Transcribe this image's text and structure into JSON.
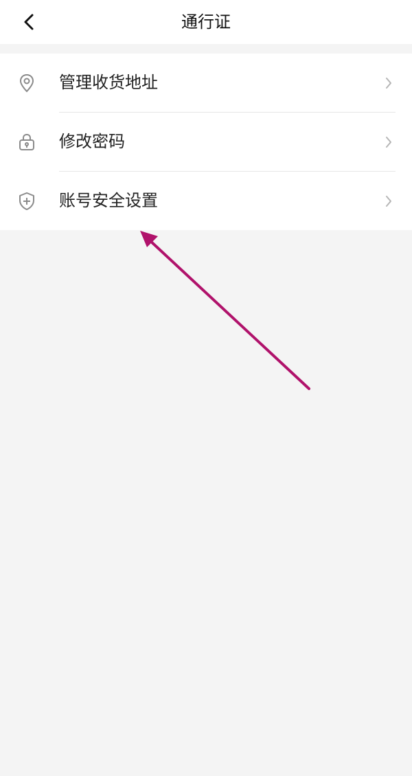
{
  "header": {
    "title": "通行证",
    "back_icon": "chevron-left-icon"
  },
  "menu": {
    "items": [
      {
        "label": "管理收货地址",
        "icon": "location-pin-icon"
      },
      {
        "label": "修改密码",
        "icon": "lock-icon"
      },
      {
        "label": "账号安全设置",
        "icon": "shield-plus-icon"
      }
    ],
    "chevron_icon": "chevron-right-icon"
  },
  "colors": {
    "background": "#f4f4f4",
    "surface": "#ffffff",
    "annotation": "#b0126b",
    "icon": "#8a8a8a",
    "divider": "#e6e6e6"
  }
}
